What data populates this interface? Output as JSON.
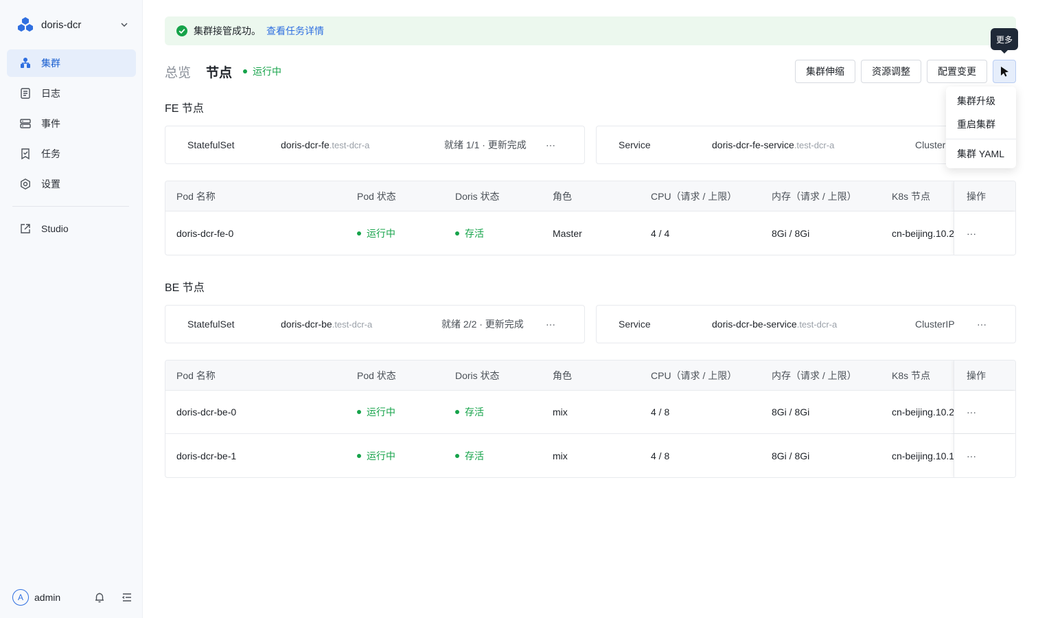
{
  "sidebar": {
    "cluster_name": "doris-dcr",
    "items": [
      {
        "label": "集群"
      },
      {
        "label": "日志"
      },
      {
        "label": "事件"
      },
      {
        "label": "任务"
      },
      {
        "label": "设置"
      },
      {
        "label": "Studio"
      }
    ],
    "user": {
      "avatar_letter": "A",
      "name": "admin"
    }
  },
  "alert": {
    "message": "集群接管成功。",
    "link": "查看任务详情"
  },
  "header": {
    "tabs": [
      {
        "label": "总览"
      },
      {
        "label": "节点"
      }
    ],
    "status": "运行中"
  },
  "actions": {
    "scale": "集群伸缩",
    "resource": "资源调整",
    "config": "配置变更",
    "more_tooltip": "更多"
  },
  "more_menu": [
    "集群升级",
    "重启集群",
    "集群 YAML"
  ],
  "fe": {
    "title": "FE 节点",
    "statefulset": {
      "kind": "StatefulSet",
      "name": "doris-dcr-fe",
      "ns": ".test-dcr-a",
      "state": "就绪 1/1 · 更新完成"
    },
    "service": {
      "kind": "Service",
      "name": "doris-dcr-fe-service",
      "ns": ".test-dcr-a",
      "type": "ClusterIP"
    },
    "rows": [
      {
        "pod": "doris-dcr-fe-0",
        "pod_status": "运行中",
        "doris_status": "存活",
        "role": "Master",
        "cpu": "4 / 4",
        "mem": "8Gi / 8Gi",
        "node": "cn-beijing.10.2"
      }
    ]
  },
  "be": {
    "title": "BE 节点",
    "statefulset": {
      "kind": "StatefulSet",
      "name": "doris-dcr-be",
      "ns": ".test-dcr-a",
      "state": "就绪 2/2 · 更新完成"
    },
    "service": {
      "kind": "Service",
      "name": "doris-dcr-be-service",
      "ns": ".test-dcr-a",
      "type": "ClusterIP"
    },
    "rows": [
      {
        "pod": "doris-dcr-be-0",
        "pod_status": "运行中",
        "doris_status": "存活",
        "role": "mix",
        "cpu": "4 / 8",
        "mem": "8Gi / 8Gi",
        "node": "cn-beijing.10.2"
      },
      {
        "pod": "doris-dcr-be-1",
        "pod_status": "运行中",
        "doris_status": "存活",
        "role": "mix",
        "cpu": "4 / 8",
        "mem": "8Gi / 8Gi",
        "node": "cn-beijing.10.1"
      }
    ]
  },
  "table_headers": {
    "pod": "Pod 名称",
    "pod_status": "Pod 状态",
    "doris_status": "Doris 状态",
    "role": "角色",
    "cpu": "CPU（请求 / 上限）",
    "mem": "内存（请求 / 上限）",
    "node": "K8s 节点",
    "op": "操作"
  },
  "more_glyph": "···",
  "colors": {
    "primary": "#2f6fe0",
    "success": "#16a34a",
    "sidebar_bg": "#f7f9fc",
    "active_bg": "#e6eefb",
    "alert_bg": "#ecf8ee"
  }
}
